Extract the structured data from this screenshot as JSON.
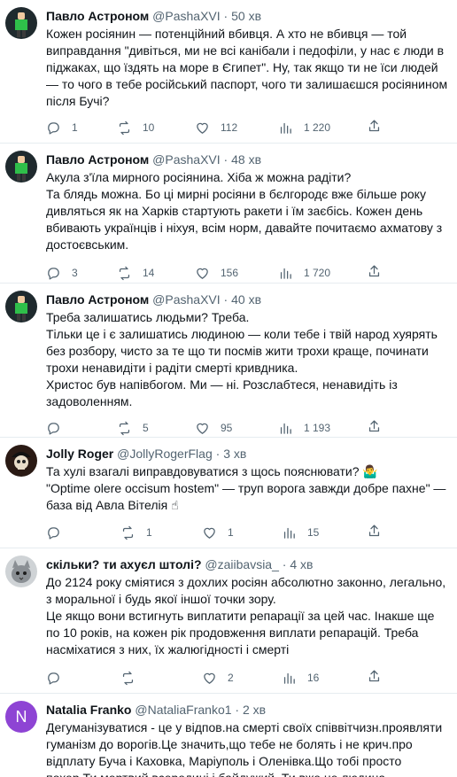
{
  "tweets": [
    {
      "name": "Павло Астроном",
      "handle": "@PashaXVI",
      "time": "50 хв",
      "avatar": "green-figure-avatar",
      "paragraphs": [
        "Кожен росіянин — потенційний вбивця. А хто не вбивця — той виправдання \"дивіться, ми не всі канібали і педофіли, у нас є люди в пiджаках, що їздять на море в Єгипет\". Ну, так якщо ти не їси людей — то чого в тебе російський паспорт, чого ти залишаєшся росіянином після Бучі?"
      ],
      "replies": "1",
      "retweets": "10",
      "likes": "112",
      "views": "1 220"
    },
    {
      "name": "Павло Астроном",
      "handle": "@PashaXVI",
      "time": "48 хв",
      "avatar": "green-figure-avatar",
      "paragraphs": [
        "Акула з'їла мирного росіянина. Хіба ж можна радіти?",
        "Та блядь можна. Бо ці мирні росіяни в бєлгородє вже більше року дивляться як на Харків стартують ракети і їм заєбісь. Кожен день вбивають українців і ніхуя, всім норм, давайте почитаємо ахматову з достоєвським."
      ],
      "replies": "3",
      "retweets": "14",
      "likes": "156",
      "views": "1 720"
    },
    {
      "name": "Павло Астроном",
      "handle": "@PashaXVI",
      "time": "40 хв",
      "avatar": "green-figure-avatar",
      "paragraphs": [
        "Треба залишатись людьми? Треба.",
        "Тільки це і є залишатись людиною — коли тебе і твій народ хуярять без розбору, чисто за те що ти посмів жити трохи краще, починати трохи ненавидіти і радіти смерті кривдника.",
        "Христос був напівбогом. Ми — ні. Розслабтеся, ненавидіть із задоволенням."
      ],
      "replies": "",
      "retweets": "5",
      "likes": "95",
      "views": "1 193"
    },
    {
      "name": "Jolly Roger",
      "handle": "@JollyRogerFlag",
      "time": "3 хв",
      "avatar": "pirate-skull-avatar",
      "paragraphs": [
        "Та хулі взагалі виправдовуватися з щось пояснювати? 🤷‍♂️",
        "\"Optime olere occisum hostem\" — труп ворога завжди добре пахне\" — база від Авла Вітелія ☝"
      ],
      "replies": "",
      "retweets": "1",
      "likes": "1",
      "views": "15"
    },
    {
      "name": "скільки? ти ахуєл штолі?",
      "handle": "@zaiibavsia_",
      "time": "4 хв",
      "avatar": "cat-avatar",
      "paragraphs": [
        "До 2124 року сміятися з дохлих росіян абсолютно законно, легально, з моральної і будь якої іншої точки зору.",
        "Це якщо вони встигнуть виплатити репарації за цей час. Інакше ще по 10 років, на кожен рік продовження виплати репарацій. Треба насміхатися з них, їх жалюгідності і смерті"
      ],
      "replies": "",
      "retweets": "",
      "likes": "2",
      "views": "16"
    },
    {
      "name": "Natalia Franko",
      "handle": "@NataliaFranko1",
      "time": "2 хв",
      "avatar": "N",
      "avatar_color": "#8e44d4",
      "paragraphs": [
        "Дегуманізуватися - це у відпов.на смерті своїх співвітчизн.проявляти гуманізм до ворогів.Це значить,що тебе не болять і не крич.про відплату Буча і Каховка, Маріуполь і Оленівка.Що тобі просто похер.Ти мертвий всередині і байдужий. Ти вже не людина."
      ],
      "replies": "",
      "retweets": "",
      "likes": "",
      "views": ""
    }
  ]
}
